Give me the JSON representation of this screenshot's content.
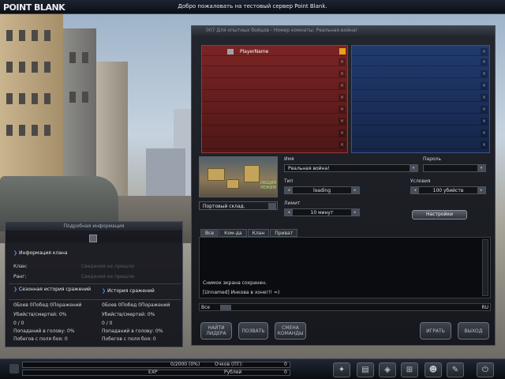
{
  "topbar": {
    "logo": "POINT BLANK",
    "welcome": "Добро пожаловать на тестовый сервер Point Blank."
  },
  "room": {
    "title": "007 Для опытных бойцов - Номер комнаты: Реальная война!",
    "red_team": [
      {
        "name": "PlayerName"
      },
      {
        "name": ""
      },
      {
        "name": ""
      },
      {
        "name": ""
      },
      {
        "name": ""
      },
      {
        "name": ""
      },
      {
        "name": ""
      },
      {
        "name": ""
      },
      {
        "name": ""
      }
    ],
    "map_badge": "ОБЩИЙ РЕЖИМ",
    "map_name": "Портовый склад.",
    "labels": {
      "name": "Имя",
      "password": "Пароль",
      "type": "Тип",
      "conditions": "Условия",
      "limit": "Лимит"
    },
    "values": {
      "name": "Реальная война!",
      "type": "loading",
      "conditions": "100 убийств",
      "limit": "10 минут"
    },
    "settings_button": "Настройки"
  },
  "chat": {
    "tabs": [
      "Все",
      "Ком-да",
      "Клан",
      "Приват"
    ],
    "lines": [
      "Снимок экрана сохранен.",
      "[Unnamed] Инкова в хоне!!! =)"
    ],
    "input_channel": "Все",
    "input_lang": "RU"
  },
  "room_buttons": {
    "find_leader": "НАЙТИ ЛИДЕРА",
    "invite": "ПОЗВАТЬ",
    "change_team": "СМЕНА КОМАНДЫ",
    "play": "ИГРАТЬ",
    "exit": "ВЫХОД"
  },
  "info_panel": {
    "title": "Подробная информация",
    "clan_header": "Информация клана",
    "clan_label": "Клан:",
    "clan_value": "Сведения не пришли",
    "rank_label": "Ранг:",
    "rank_value": "Сведения не пришли",
    "season_header": "Сезонная история сражений",
    "history_header": "История сражений",
    "left_stats": [
      "0Боев 0Побед 0Поражений",
      "Убийств/смертей: 0%",
      "0 / 0",
      "Попаданий в голову: 0%",
      "Побегов с поля боя: 0"
    ],
    "right_stats": [
      "0Боев 0Побед 0Поражений",
      "Убийств/смертей: 0%",
      "0 / 0",
      "Попаданий в голову: 0%",
      "Побегов с поля боя: 0"
    ]
  },
  "bottombar": {
    "exp_text": "0/2000 (0%)",
    "exp_label": "EXP",
    "exp_progress": 0,
    "points_label": "Очков (ПТ):",
    "points_value": "0",
    "rubles_label": "Рублей",
    "rubles_value": "0",
    "nav_icons": [
      "inventory-icon",
      "shop-icon",
      "gift-shop-icon",
      "cart-icon",
      "profile-icon",
      "options-icon",
      "power-icon"
    ]
  }
}
